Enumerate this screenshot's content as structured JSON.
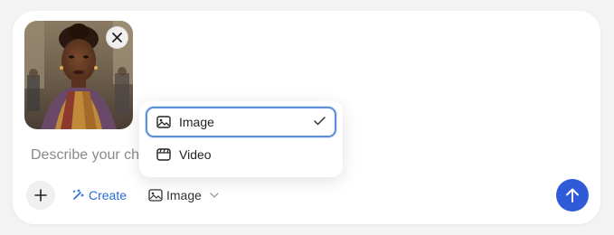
{
  "composer": {
    "attachment": {
      "icons": {
        "remove": "close-icon"
      }
    },
    "prompt_placeholder": "Describe your ch",
    "toolbar": {
      "add_icon": "plus-icon",
      "create_label": "Create",
      "create_icon": "magic-wand-icon",
      "mode_label": "Image",
      "mode_icon": "image-icon",
      "mode_chevron": "chevron-down-icon",
      "send_icon": "arrow-up-icon"
    }
  },
  "dropdown": {
    "items": [
      {
        "label": "Image",
        "icon": "image-icon",
        "selected": true
      },
      {
        "label": "Video",
        "icon": "video-icon",
        "selected": false
      }
    ]
  },
  "colors": {
    "accent": "#2a6ad8",
    "send_button": "#2f5bd8",
    "selected_border": "#5b8fd8"
  }
}
